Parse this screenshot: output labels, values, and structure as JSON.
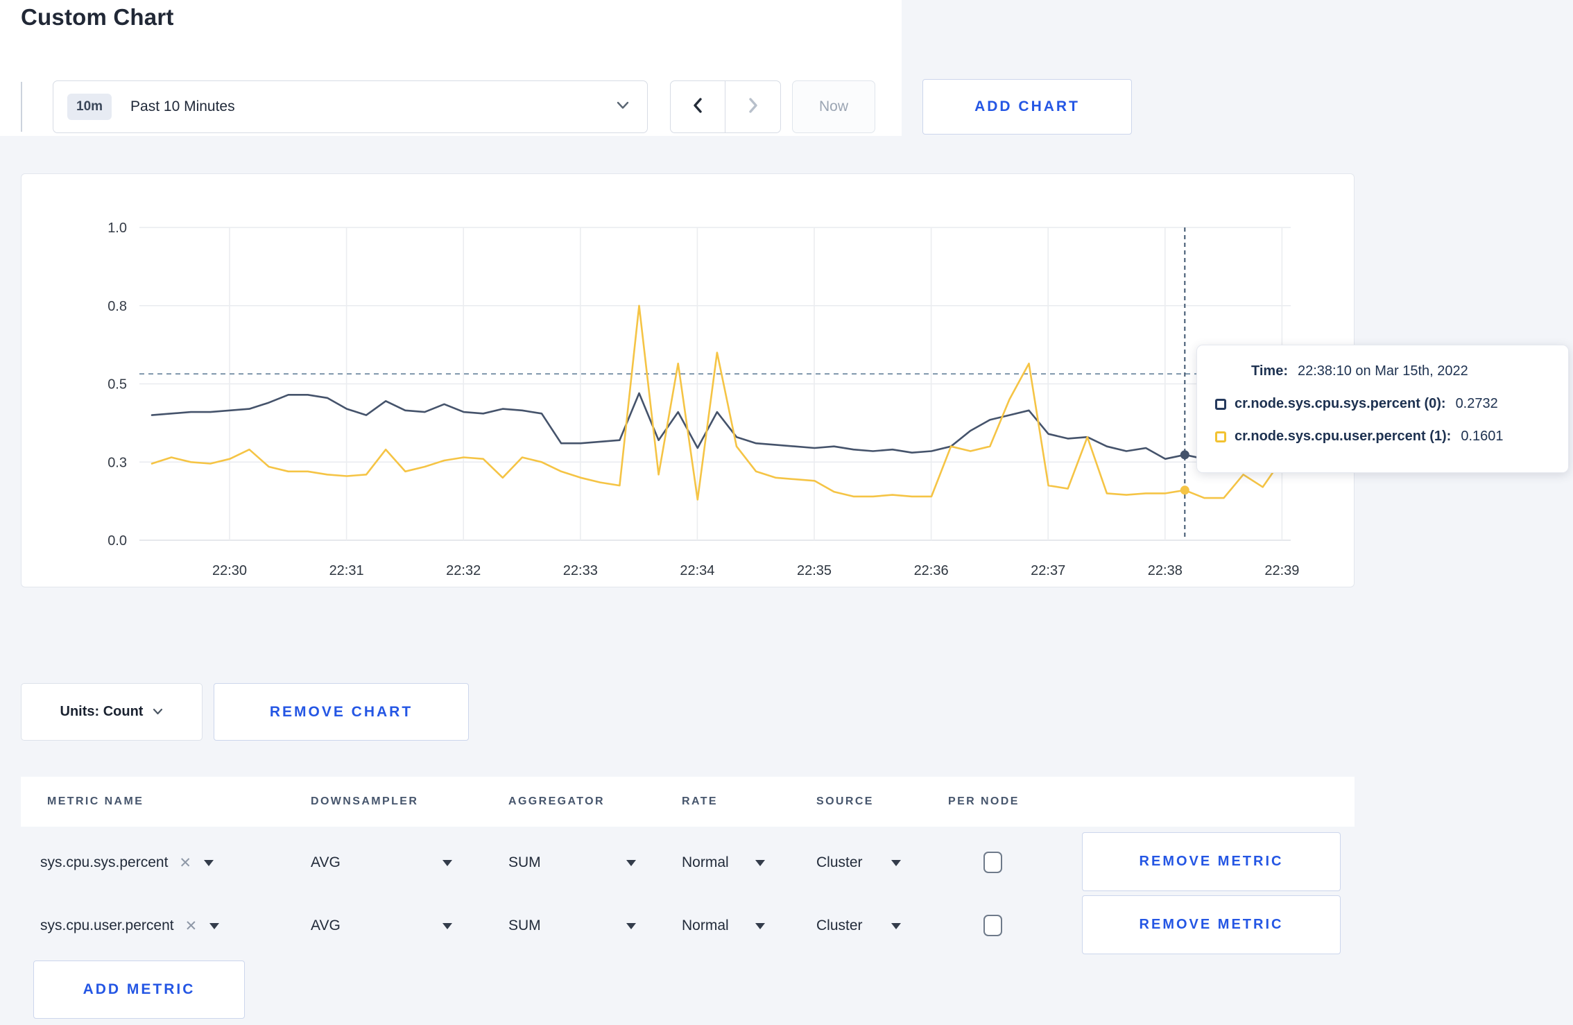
{
  "theme": {
    "accent_blue": "#2456e4",
    "page_bg": "#f3f5f9",
    "tooltip_text": "#1d3150",
    "series_sys_color": "#45536b",
    "series_user_color": "#f5c445"
  },
  "page": {
    "title": "Custom Chart"
  },
  "toolbar": {
    "range_badge": "10m",
    "range_label": "Past 10 Minutes",
    "now_label": "Now",
    "add_chart_label": "ADD CHART"
  },
  "tooltip": {
    "time_label": "Time:",
    "time_value": "22:38:10 on Mar 15th, 2022",
    "series": [
      {
        "label": "cr.node.sys.cpu.sys.percent (0):",
        "value": "0.2732",
        "color": "#263a5d"
      },
      {
        "label": "cr.node.sys.cpu.user.percent (1):",
        "value": "0.1601",
        "color": "#f2c232"
      }
    ]
  },
  "chart_actions": {
    "units_label": "Units: Count",
    "remove_chart_label": "REMOVE CHART"
  },
  "metrics_table": {
    "headers": [
      "METRIC NAME",
      "DOWNSAMPLER",
      "AGGREGATOR",
      "RATE",
      "SOURCE",
      "PER NODE"
    ],
    "rows": [
      {
        "metric": "sys.cpu.sys.percent",
        "downsampler": "AVG",
        "aggregator": "SUM",
        "rate": "Normal",
        "source": "Cluster",
        "per_node_checked": false,
        "remove_label": "REMOVE METRIC"
      },
      {
        "metric": "sys.cpu.user.percent",
        "downsampler": "AVG",
        "aggregator": "SUM",
        "rate": "Normal",
        "source": "Cluster",
        "per_node_checked": false,
        "remove_label": "REMOVE METRIC"
      }
    ],
    "add_metric_label": "ADD METRIC"
  },
  "chart_data": {
    "type": "line",
    "title": "",
    "xlabel": "",
    "ylabel": "",
    "ylim": [
      0,
      1
    ],
    "grid": true,
    "legend_position": "tooltip",
    "start_time": "22:29:20",
    "interval_seconds": 10,
    "x_tick_labels": [
      "22:30",
      "22:31",
      "22:32",
      "22:33",
      "22:34",
      "22:35",
      "22:36",
      "22:37",
      "22:38",
      "22:39"
    ],
    "y_tick_labels": [
      "0.0",
      "0.3",
      "0.5",
      "0.8",
      "1.0"
    ],
    "y_tick_values": [
      0,
      0.25,
      0.5,
      0.75,
      1.0
    ],
    "series": [
      {
        "name": "cr.node.sys.cpu.sys.percent",
        "color": "#45536b",
        "values": [
          0.4,
          0.405,
          0.41,
          0.41,
          0.415,
          0.42,
          0.44,
          0.465,
          0.465,
          0.455,
          0.42,
          0.4,
          0.445,
          0.415,
          0.41,
          0.435,
          0.41,
          0.405,
          0.42,
          0.415,
          0.405,
          0.31,
          0.31,
          0.315,
          0.32,
          0.47,
          0.32,
          0.41,
          0.295,
          0.41,
          0.33,
          0.31,
          0.305,
          0.3,
          0.295,
          0.3,
          0.29,
          0.285,
          0.29,
          0.28,
          0.285,
          0.3,
          0.35,
          0.385,
          0.4,
          0.415,
          0.34,
          0.325,
          0.33,
          0.3,
          0.285,
          0.295,
          0.26,
          0.2732,
          0.26,
          0.25,
          0.26,
          0.27,
          0.275
        ]
      },
      {
        "name": "cr.node.sys.cpu.user.percent",
        "color": "#f5c445",
        "values": [
          0.245,
          0.265,
          0.25,
          0.245,
          0.26,
          0.29,
          0.235,
          0.22,
          0.22,
          0.21,
          0.205,
          0.21,
          0.29,
          0.22,
          0.235,
          0.255,
          0.265,
          0.26,
          0.2,
          0.265,
          0.25,
          0.22,
          0.2,
          0.185,
          0.175,
          0.75,
          0.21,
          0.565,
          0.13,
          0.6,
          0.3,
          0.22,
          0.2,
          0.195,
          0.19,
          0.155,
          0.14,
          0.14,
          0.145,
          0.14,
          0.14,
          0.3,
          0.285,
          0.3,
          0.45,
          0.565,
          0.175,
          0.165,
          0.33,
          0.15,
          0.145,
          0.15,
          0.15,
          0.1601,
          0.135,
          0.135,
          0.21,
          0.17,
          0.26
        ]
      }
    ],
    "crosshair": {
      "index": 53,
      "time": "22:38:10",
      "hline_value": 0.532,
      "point_values": [
        0.2732,
        0.1601
      ]
    }
  }
}
